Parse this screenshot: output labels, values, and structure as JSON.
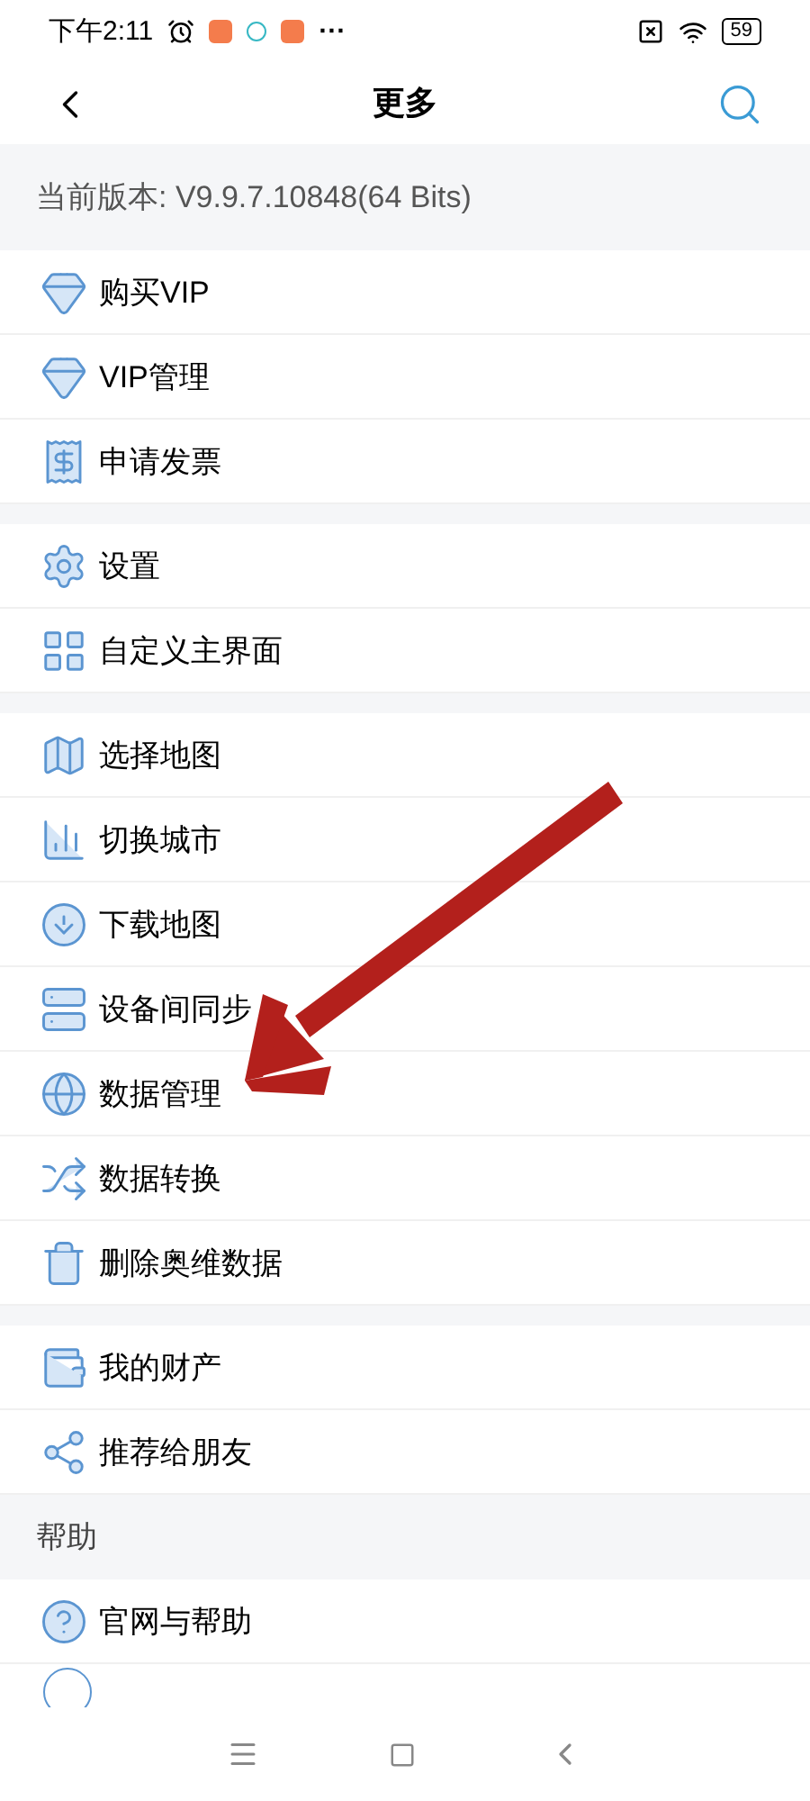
{
  "status_bar": {
    "time": "下午2:11",
    "more": "···",
    "battery": "59"
  },
  "header": {
    "title": "更多"
  },
  "version": "当前版本: V9.9.7.10848(64 Bits)",
  "sections": [
    {
      "items": [
        {
          "label": "购买VIP"
        },
        {
          "label": "VIP管理"
        },
        {
          "label": "申请发票"
        }
      ]
    },
    {
      "items": [
        {
          "label": "设置"
        },
        {
          "label": "自定义主界面"
        }
      ]
    },
    {
      "items": [
        {
          "label": "选择地图"
        },
        {
          "label": "切换城市"
        },
        {
          "label": "下载地图"
        },
        {
          "label": "设备间同步"
        },
        {
          "label": "数据管理"
        },
        {
          "label": "数据转换"
        },
        {
          "label": "删除奥维数据"
        }
      ]
    },
    {
      "items": [
        {
          "label": "我的财产"
        },
        {
          "label": "推荐给朋友"
        }
      ]
    },
    {
      "heading": "帮助",
      "items": [
        {
          "label": "官网与帮助"
        }
      ]
    }
  ]
}
